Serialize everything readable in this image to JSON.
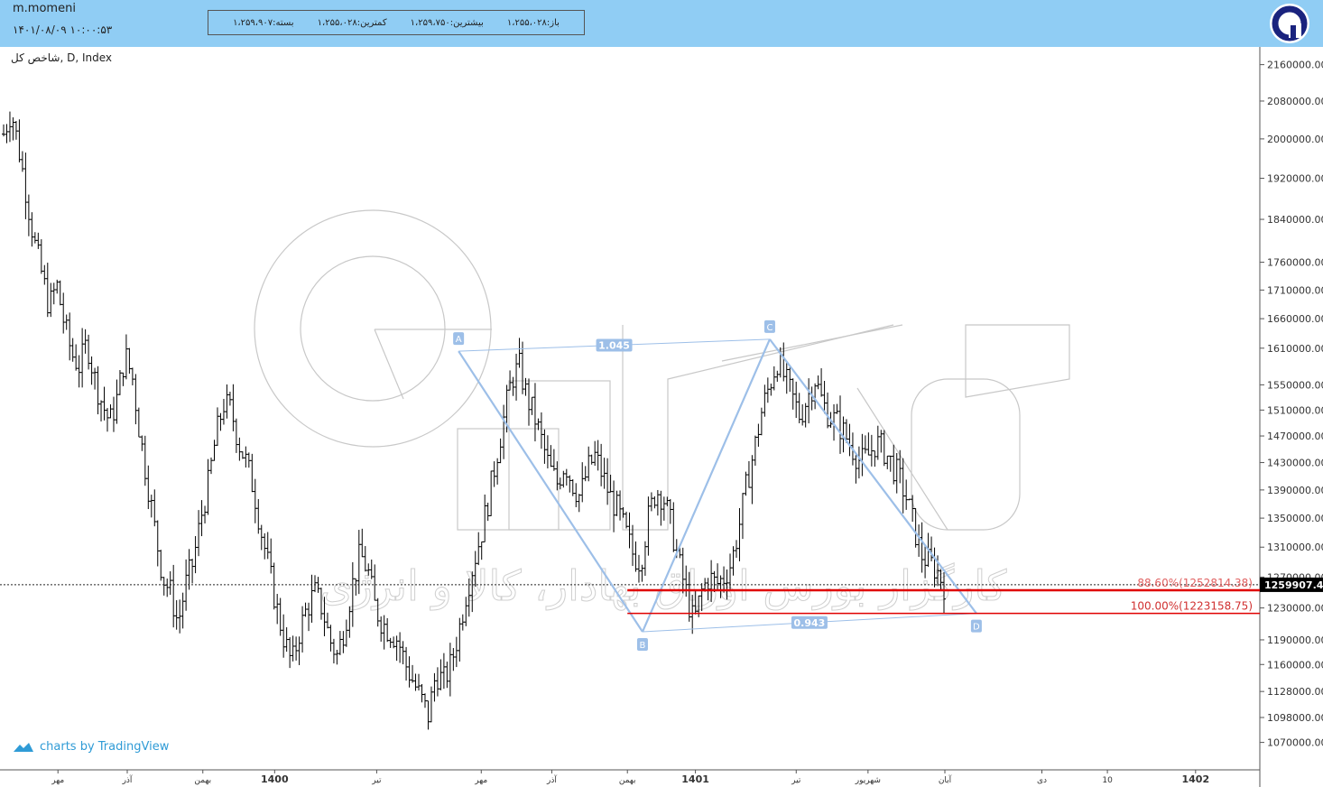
{
  "header": {
    "username": "m.momeni",
    "timestamp": "۱۴۰۱/۰۸/۰۹ ۱۰:۰۰:۵۳",
    "ohlc": [
      {
        "label": "باز:",
        "value": "۱،۲۵۵،۰۲۸"
      },
      {
        "label": "بیشترین:",
        "value": "۱،۲۵۹،۷۵۰"
      },
      {
        "label": "کمترین:",
        "value": "۱،۲۵۵،۰۲۸"
      },
      {
        "label": "بسته:",
        "value": "۱،۲۵۹،۹۰۷"
      }
    ],
    "logo_icon": "broker-logo-icon"
  },
  "symbol_label": "شاخص کل, D, Index",
  "attribution": "charts by TradingView",
  "watermark_text": "کارگزار بورس اوراق بهادار، کالا و انرژی",
  "colors": {
    "topbar": "#90cdf4",
    "pattern": "#9dbfe8",
    "fib": "#e00000",
    "fib_label_886": "#e06060",
    "fib_label_100": "#d03030",
    "candle": "#000000",
    "price_box": "#000000"
  },
  "chart_data": {
    "type": "bar",
    "title": "",
    "xlabel": "",
    "ylabel": "",
    "scale": "log",
    "ylim": [
      1040000,
      2200000
    ],
    "y_ticks": [
      2160000,
      2080000,
      2000000,
      1920000,
      1840000,
      1760000,
      1710000,
      1660000,
      1610000,
      1550000,
      1510000,
      1470000,
      1430000,
      1390000,
      1350000,
      1310000,
      1270000,
      1230000,
      1190000,
      1160000,
      1128000,
      1098000,
      1070000
    ],
    "y_tick_labels": [
      "2160000.00",
      "2080000.00",
      "2000000.00",
      "1920000.00",
      "1840000.00",
      "1760000.00",
      "1710000.00",
      "1660000.00",
      "1610000.00",
      "1550000.00",
      "1510000.00",
      "1470000.00",
      "1430000.00",
      "1390000.00",
      "1350000.00",
      "1310000.00",
      "1270000.00",
      "1230000.00",
      "1190000.00",
      "1160000.00",
      "1128000.00",
      "1098000.00",
      "1070000.00"
    ],
    "x_ticks": [
      {
        "label": "مهر",
        "pos": 0.046
      },
      {
        "label": "آذر",
        "pos": 0.101
      },
      {
        "label": "بهمن",
        "pos": 0.161
      },
      {
        "label": "1400",
        "pos": 0.218,
        "bold": true
      },
      {
        "label": "تیر",
        "pos": 0.299
      },
      {
        "label": "مهر",
        "pos": 0.382
      },
      {
        "label": "آذر",
        "pos": 0.438
      },
      {
        "label": "بهمن",
        "pos": 0.498
      },
      {
        "label": "1401",
        "pos": 0.552,
        "bold": true
      },
      {
        "label": "تیر",
        "pos": 0.632
      },
      {
        "label": "شهریور",
        "pos": 0.689
      },
      {
        "label": "آبان",
        "pos": 0.75
      },
      {
        "label": "دی",
        "pos": 0.827
      },
      {
        "label": "10",
        "pos": 0.879
      },
      {
        "label": "1402",
        "pos": 0.949,
        "bold": true
      }
    ],
    "closes": [
      2010000,
      2060000,
      1980000,
      1890000,
      1800000,
      1740000,
      1680000,
      1720000,
      1650000,
      1600000,
      1580000,
      1620000,
      1560000,
      1520000,
      1490000,
      1530000,
      1600000,
      1560000,
      1470000,
      1400000,
      1330000,
      1270000,
      1250000,
      1210000,
      1260000,
      1290000,
      1350000,
      1400000,
      1470000,
      1520000,
      1510000,
      1460000,
      1430000,
      1390000,
      1330000,
      1280000,
      1230000,
      1190000,
      1160000,
      1200000,
      1230000,
      1250000,
      1230000,
      1190000,
      1170000,
      1210000,
      1260000,
      1300000,
      1280000,
      1230000,
      1210000,
      1200000,
      1190000,
      1160000,
      1140000,
      1120000,
      1100000,
      1150000,
      1140000,
      1160000,
      1200000,
      1250000,
      1290000,
      1330000,
      1380000,
      1440000,
      1500000,
      1560000,
      1580000,
      1530000,
      1500000,
      1460000,
      1420000,
      1400000,
      1430000,
      1400000,
      1380000,
      1420000,
      1440000,
      1410000,
      1380000,
      1360000,
      1330000,
      1300000,
      1290000,
      1350000,
      1390000,
      1380000,
      1340000,
      1290000,
      1250000,
      1210000,
      1250000,
      1270000,
      1260000,
      1270000,
      1290000,
      1340000,
      1400000,
      1450000,
      1510000,
      1550000,
      1590000,
      1560000,
      1530000,
      1500000,
      1530000,
      1560000,
      1520000,
      1500000,
      1490000,
      1470000,
      1450000,
      1430000,
      1440000,
      1460000,
      1450000,
      1430000,
      1410000,
      1380000,
      1340000,
      1300000,
      1290000,
      1280000,
      1259907
    ],
    "current_price": 1259907.42,
    "current_price_label": "1259907.42",
    "pattern": {
      "points": [
        {
          "label": "A",
          "price": 1605000,
          "pos": 0.364
        },
        {
          "label": "B",
          "price": 1200000,
          "pos": 0.51
        },
        {
          "label": "C",
          "price": 1625000,
          "pos": 0.611
        },
        {
          "label": "D",
          "price": 1223158,
          "pos": 0.775
        }
      ],
      "ratio_ac": "1.045",
      "ratio_bd": "0.943"
    },
    "fib_levels": [
      {
        "label": "88.60%(1252814.38)",
        "price": 1252814.38
      },
      {
        "label": "100.00%(1223158.75)",
        "price": 1223158.75
      }
    ]
  }
}
